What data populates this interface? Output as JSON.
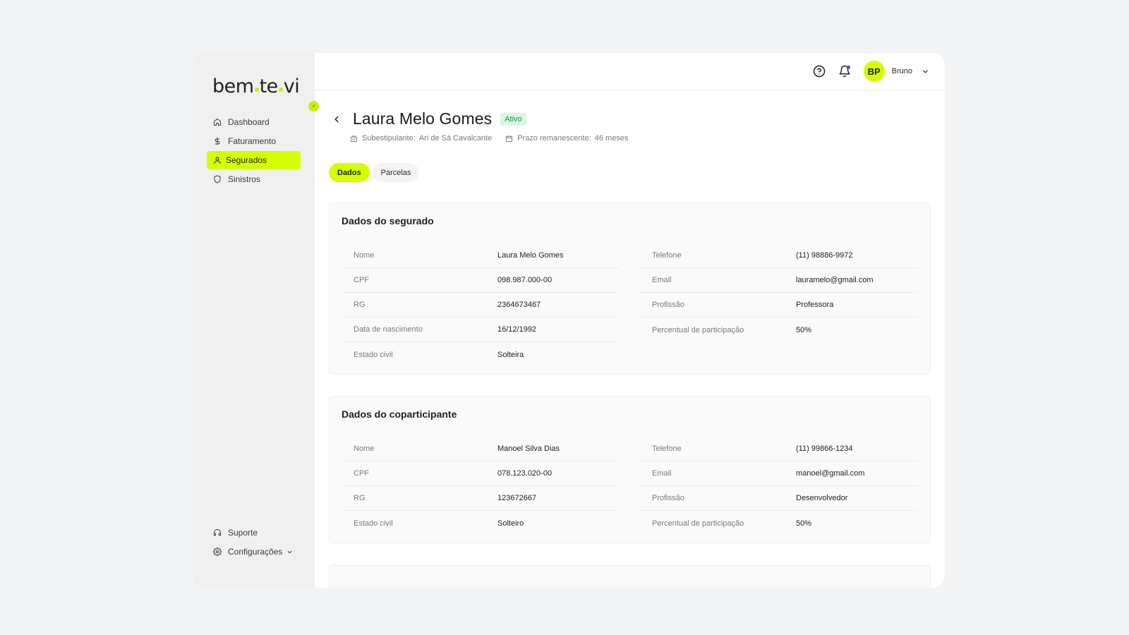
{
  "brand": {
    "logo_part1": "bem",
    "logo_part2": "te",
    "logo_part3": "vi"
  },
  "sidebar": {
    "items": [
      {
        "label": "Dashboard",
        "icon": "home-icon"
      },
      {
        "label": "Faturamento",
        "icon": "dollar-icon"
      },
      {
        "label": "Segurados",
        "icon": "user-icon",
        "active": true
      },
      {
        "label": "Sinistros",
        "icon": "shield-icon"
      }
    ],
    "bottom": [
      {
        "label": "Suporte",
        "icon": "headset-icon"
      },
      {
        "label": "Configurações",
        "icon": "gear-icon"
      }
    ]
  },
  "topbar": {
    "avatar_initials": "BP",
    "user_name": "Bruno"
  },
  "page": {
    "title": "Laura Melo Gomes",
    "status": "Ativo",
    "substipulante_label": "Subestipulante:",
    "substipulante_value": "Ari de Sá Cavalcante",
    "prazo_label": "Prazo remanescente:",
    "prazo_value": "46 meses"
  },
  "tabs": [
    {
      "label": "Dados",
      "active": true
    },
    {
      "label": "Parcelas"
    }
  ],
  "segurado": {
    "title": "Dados do segurado",
    "left": [
      {
        "label": "Nome",
        "value": "Laura Melo Gomes"
      },
      {
        "label": "CPF",
        "value": "098.987.000-00"
      },
      {
        "label": "RG",
        "value": "2364673467"
      },
      {
        "label": "Data de nascimento",
        "value": "16/12/1992"
      },
      {
        "label": "Estado civil",
        "value": "Solteira"
      }
    ],
    "right": [
      {
        "label": "Telefone",
        "value": "(11) 98886-9972"
      },
      {
        "label": "Email",
        "value": "lauramelo@gmail.com"
      },
      {
        "label": "Profissão",
        "value": "Professora"
      },
      {
        "label": "Percentual de participação",
        "value": "50%"
      }
    ]
  },
  "coparticipante": {
    "title": "Dados do coparticipante",
    "left": [
      {
        "label": "Nome",
        "value": "Manoel Silva Dias"
      },
      {
        "label": "CPF",
        "value": "078.123.020-00"
      },
      {
        "label": "RG",
        "value": "123672667"
      },
      {
        "label": "Estado civil",
        "value": "Solteiro"
      }
    ],
    "right": [
      {
        "label": "Telefone",
        "value": "(11) 99866-1234"
      },
      {
        "label": "Email",
        "value": "manoel@gmail.com"
      },
      {
        "label": "Profissão",
        "value": "Desenvolvedor"
      },
      {
        "label": "Percentual de participação",
        "value": "50%"
      }
    ]
  },
  "colors": {
    "accent": "#d4ff00",
    "badge_bg": "#d8f7e2",
    "badge_text": "#1f8a4c",
    "notification_dot": "#5b3df5"
  }
}
